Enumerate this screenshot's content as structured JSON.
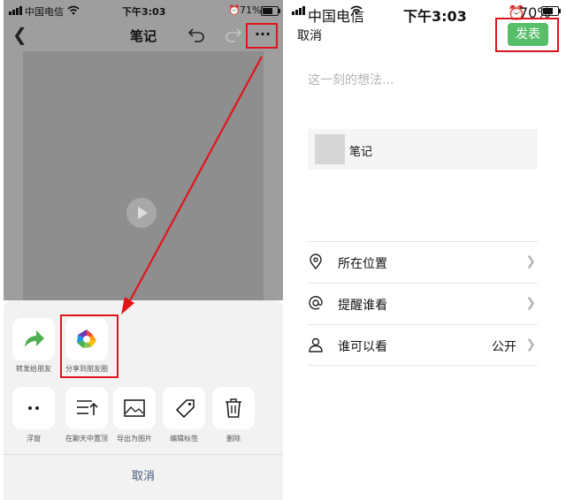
{
  "left_screen": {
    "status_bar": {
      "carrier": "中国电信",
      "time": "下午3:03",
      "battery_pct": "71%",
      "battery_level": 0.71
    },
    "navbar": {
      "back_icon": "chevron-left-icon",
      "title": "笔记",
      "more_label": "···"
    },
    "video": {
      "play_icon": "play-icon"
    },
    "share_sheet": {
      "top_row": [
        {
          "label": "转发给朋友",
          "icon": "forward-arrow-icon"
        },
        {
          "label": "分享到朋友圈",
          "icon": "moments-icon"
        }
      ],
      "bottom_row": [
        {
          "label": "浮窗",
          "icon": "float-window-icon"
        },
        {
          "label": "在聊天中置顶",
          "icon": "pin-to-top-icon"
        },
        {
          "label": "导出为图片",
          "icon": "image-icon"
        },
        {
          "label": "编辑标签",
          "icon": "tag-icon"
        },
        {
          "label": "删除",
          "icon": "trash-icon"
        }
      ],
      "cancel": "取消"
    }
  },
  "right_screen": {
    "status_bar": {
      "carrier": "中国电信",
      "time": "下午3:03",
      "battery_pct": "70%",
      "battery_level": 0.7
    },
    "header": {
      "cancel": "取消",
      "publish": "发表"
    },
    "placeholder": "这一刻的想法...",
    "attachment": {
      "title": "笔记"
    },
    "rows": [
      {
        "label": "所在位置",
        "value": "",
        "icon": "location-pin-icon"
      },
      {
        "label": "提醒谁看",
        "value": "",
        "icon": "at-sign-icon"
      },
      {
        "label": "谁可以看",
        "value": "公开",
        "icon": "person-icon"
      }
    ]
  },
  "colors": {
    "accent_green": "#57be6a",
    "highlight_red": "#e0151c",
    "link_blue": "#44597a",
    "share_green": "#4caf50"
  }
}
